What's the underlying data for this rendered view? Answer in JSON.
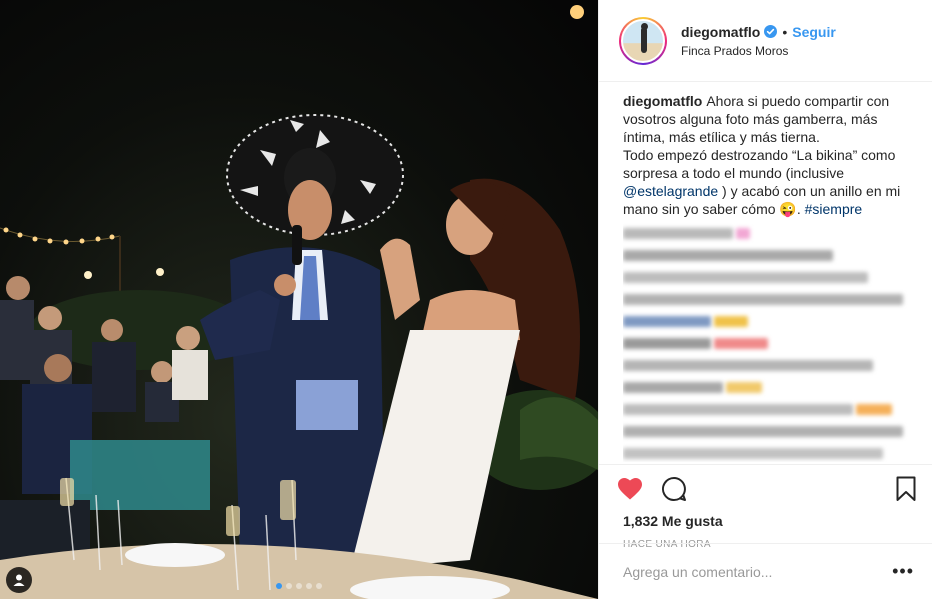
{
  "post": {
    "username": "diegomatflo",
    "verified": true,
    "follow_label": "Seguir",
    "separator": "•",
    "location": "Finca Prados Moros",
    "caption_user": "diegomatflo",
    "caption_text_1": "Ahora si puedo compartir con vosotros alguna foto más gamberra, más íntima, más etílica y más tierna.\nTodo empezó destrozando “La bikina” como sorpresa a todo el mundo (inclusive ",
    "caption_mention": "@estelagrande",
    "caption_text_2": " ) y acabó con un anillo en mi mano sin yo saber cómo 😜. ",
    "caption_hashtag": "#siempre",
    "likes": "1,832 Me gusta",
    "time": "HACE UNA HORA",
    "comment_placeholder": "Agrega un comentario...",
    "more_label": "•••"
  },
  "icons": {
    "verified": "verified-badge-icon",
    "like": "heart-icon",
    "comment": "comment-bubble-icon",
    "save": "bookmark-icon",
    "user_tag": "user-tag-icon"
  },
  "colors": {
    "accent": "#3897f0",
    "like": "#ed4956",
    "mention": "#003569"
  }
}
